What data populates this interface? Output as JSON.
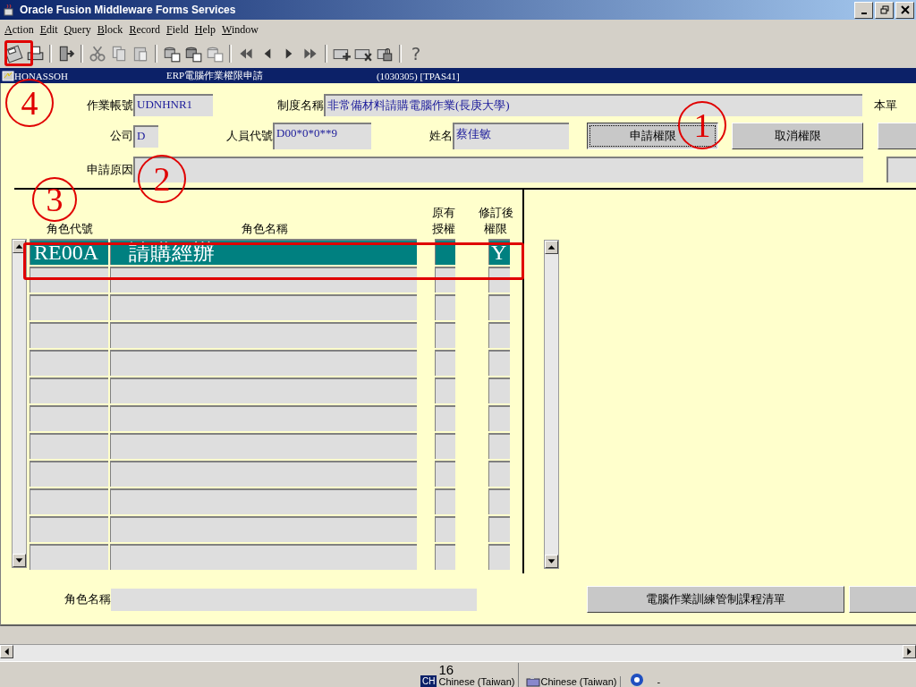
{
  "window": {
    "title": "Oracle Fusion Middleware Forms Services"
  },
  "menu": [
    "Action",
    "Edit",
    "Query",
    "Block",
    "Record",
    "Field",
    "Help",
    "Window"
  ],
  "toolbar": [
    {
      "kind": "save"
    },
    {
      "kind": "print"
    },
    {
      "kind": "sep"
    },
    {
      "kind": "exit"
    },
    {
      "kind": "sep"
    },
    {
      "kind": "cut"
    },
    {
      "kind": "copy"
    },
    {
      "kind": "paste"
    },
    {
      "kind": "sep"
    },
    {
      "kind": "enter-query"
    },
    {
      "kind": "execute-query"
    },
    {
      "kind": "cancel-query"
    },
    {
      "kind": "sep"
    },
    {
      "kind": "first"
    },
    {
      "kind": "prev"
    },
    {
      "kind": "next"
    },
    {
      "kind": "last"
    },
    {
      "kind": "sep"
    },
    {
      "kind": "insert"
    },
    {
      "kind": "delete"
    },
    {
      "kind": "lock"
    },
    {
      "kind": "sep"
    },
    {
      "kind": "help",
      "label": "?"
    }
  ],
  "form_title": {
    "module": "HONASSOH",
    "title": "ERP電腦作業權限申請",
    "code": "(1030305) [TPAS41]"
  },
  "header": {
    "account_label": "作業帳號",
    "account": "UDNHNR1",
    "system_label": "制度名稱",
    "system": "非常備材料請購電腦作業(長庚大學)",
    "form_note_label": "本單",
    "company_label": "公司",
    "company": "D",
    "staff_label": "人員代號",
    "staff": "D00*0*0**9",
    "name_label": "姓名",
    "name": "蔡佳敏",
    "reason_label": "申請原因"
  },
  "buttons": [
    {
      "label": "申請權限",
      "focused": true
    },
    {
      "label": "取消權限",
      "focused": false
    }
  ],
  "table": {
    "columns": [
      "角色代號",
      "角色名稱",
      "原有授權",
      "修訂後權限"
    ],
    "rows": [
      {
        "selected": true,
        "code": "RE00A",
        "name": "請購經辦",
        "revised": "Y"
      },
      {
        "selected": false
      },
      {
        "selected": false
      },
      {
        "selected": false
      },
      {
        "selected": false
      },
      {
        "selected": false
      },
      {
        "selected": false
      },
      {
        "selected": false
      },
      {
        "selected": false
      },
      {
        "selected": false
      },
      {
        "selected": false
      },
      {
        "selected": false
      }
    ]
  },
  "footer": {
    "role_label": "角色名稱",
    "buttons": [
      "電腦作業訓練管制課程清單"
    ]
  },
  "status_bar": {
    "count": "16",
    "ime_badge": "CH",
    "ime": "Chinese (Taiwan)",
    "keyboard": "Chinese (Taiwan)",
    "message": "-"
  },
  "annotations": [
    {
      "kind": "circle",
      "label": "1"
    },
    {
      "kind": "circle",
      "label": "2"
    },
    {
      "kind": "circle",
      "label": "3"
    },
    {
      "kind": "circle",
      "label": "4"
    },
    {
      "kind": "rect"
    },
    {
      "kind": "rect"
    }
  ]
}
